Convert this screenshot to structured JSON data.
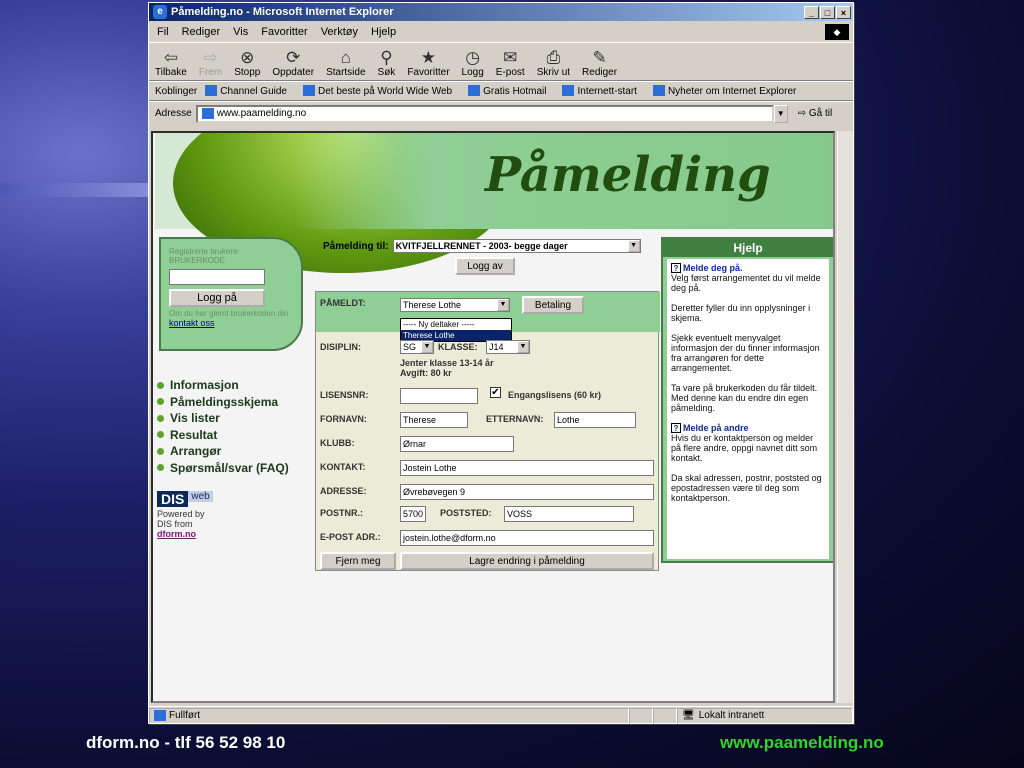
{
  "window": {
    "title": "Påmelding.no - Microsoft Internet Explorer"
  },
  "menu": [
    "Fil",
    "Rediger",
    "Vis",
    "Favoritter",
    "Verktøy",
    "Hjelp"
  ],
  "toolbar": [
    {
      "label": "Tilbake",
      "icon": "back-arrow-icon"
    },
    {
      "label": "Frem",
      "icon": "forward-arrow-icon"
    },
    {
      "label": "Stopp",
      "icon": "stop-icon"
    },
    {
      "label": "Oppdater",
      "icon": "refresh-icon"
    },
    {
      "label": "Startside",
      "icon": "home-icon"
    },
    {
      "label": "Søk",
      "icon": "search-icon"
    },
    {
      "label": "Favoritter",
      "icon": "favorites-icon"
    },
    {
      "label": "Logg",
      "icon": "history-icon"
    },
    {
      "label": "E-post",
      "icon": "mail-icon"
    },
    {
      "label": "Skriv ut",
      "icon": "print-icon"
    },
    {
      "label": "Rediger",
      "icon": "edit-icon"
    }
  ],
  "links": {
    "label": "Koblinger",
    "items": [
      "Channel Guide",
      "Det beste på World Wide Web",
      "Gratis Hotmail",
      "Internett-start",
      "Nyheter om Internet Explorer"
    ]
  },
  "address": {
    "label": "Adresse",
    "value": "www.paamelding.no",
    "go": "Gå til"
  },
  "banner": {
    "title": "Påmelding"
  },
  "login": {
    "label": "Registrerte brukere:",
    "code_label": "BRUKERKODE",
    "button": "Logg på",
    "forgot": "Om du har glemt brukerkoden din",
    "contact": "kontakt oss"
  },
  "nav": [
    "Informasjon",
    "Påmeldingsskjema",
    "Vis lister",
    "Resultat",
    "Arrangør",
    "Spørsmål/svar (FAQ)"
  ],
  "dis": {
    "box": "DIS",
    "web": "web",
    "powered": "Powered by",
    "from": "DIS from",
    "link": "dform.no"
  },
  "form": {
    "pamelding_label": "Påmelding til:",
    "event": "KVITFJELLRENNET - 2003- begge dager",
    "logout": "Logg av",
    "pameldt_label": "PÅMELDT:",
    "pameldt_value": "Therese Lothe",
    "betaling": "Betaling",
    "options": [
      "----- Ny deltaker -----",
      "Therese Lothe"
    ],
    "disiplin_label": "DISIPLIN:",
    "disiplin_value": "SG",
    "klasse_label": "KLASSE:",
    "klasse_value": "J14",
    "class_info": "Jenter klasse 13-14 år",
    "fee": "Avgift: 80 kr",
    "lisens_label": "LISENSNR:",
    "lisens_value": "",
    "engang_label": "Engangslisens (60 kr)",
    "fornavn_label": "FORNAVN:",
    "fornavn": "Therese",
    "etternavn_label": "ETTERNAVN:",
    "etternavn": "Lothe",
    "klubb_label": "KLUBB:",
    "klubb": "Ørnar",
    "kontakt_label": "KONTAKT:",
    "kontakt": "Jostein Lothe",
    "adresse_label": "ADRESSE:",
    "adresse": "Øvrebøvegen 9",
    "postnr_label": "POSTNR.:",
    "postnr": "5700",
    "poststed_label": "POSTSTED:",
    "poststed": "VOSS",
    "epost_label": "E-POST ADR.:",
    "epost": "jostein.lothe@dform.no",
    "remove": "Fjern meg",
    "save": "Lagre endring i påmelding"
  },
  "help": {
    "title": "Hjelp",
    "h1": "Melde deg på.",
    "p1": "Velg først arrangementet du vil melde deg på.",
    "p2": "Deretter fyller du inn opplysninger i skjema.",
    "p3": "Sjekk eventuelt menyvalget informasjon der du finner informasjon fra arrangøren for dette arrangementet.",
    "p4": "Ta vare på brukerkoden du får tildelt. Med denne kan du endre din egen påmelding.",
    "h2": "Melde på andre",
    "p5": "Hvis du er kontaktperson og melder på flere andre, oppgi navnet ditt som kontakt.",
    "p6": "Da skal adressen, postnr, poststed og epostadressen være til deg som kontaktperson."
  },
  "status": {
    "left": "Fullført",
    "zone": "Lokalt intranett"
  },
  "footer": {
    "left": "dform.no - tlf  56 52 98 10",
    "right": "www.paamelding.no"
  }
}
